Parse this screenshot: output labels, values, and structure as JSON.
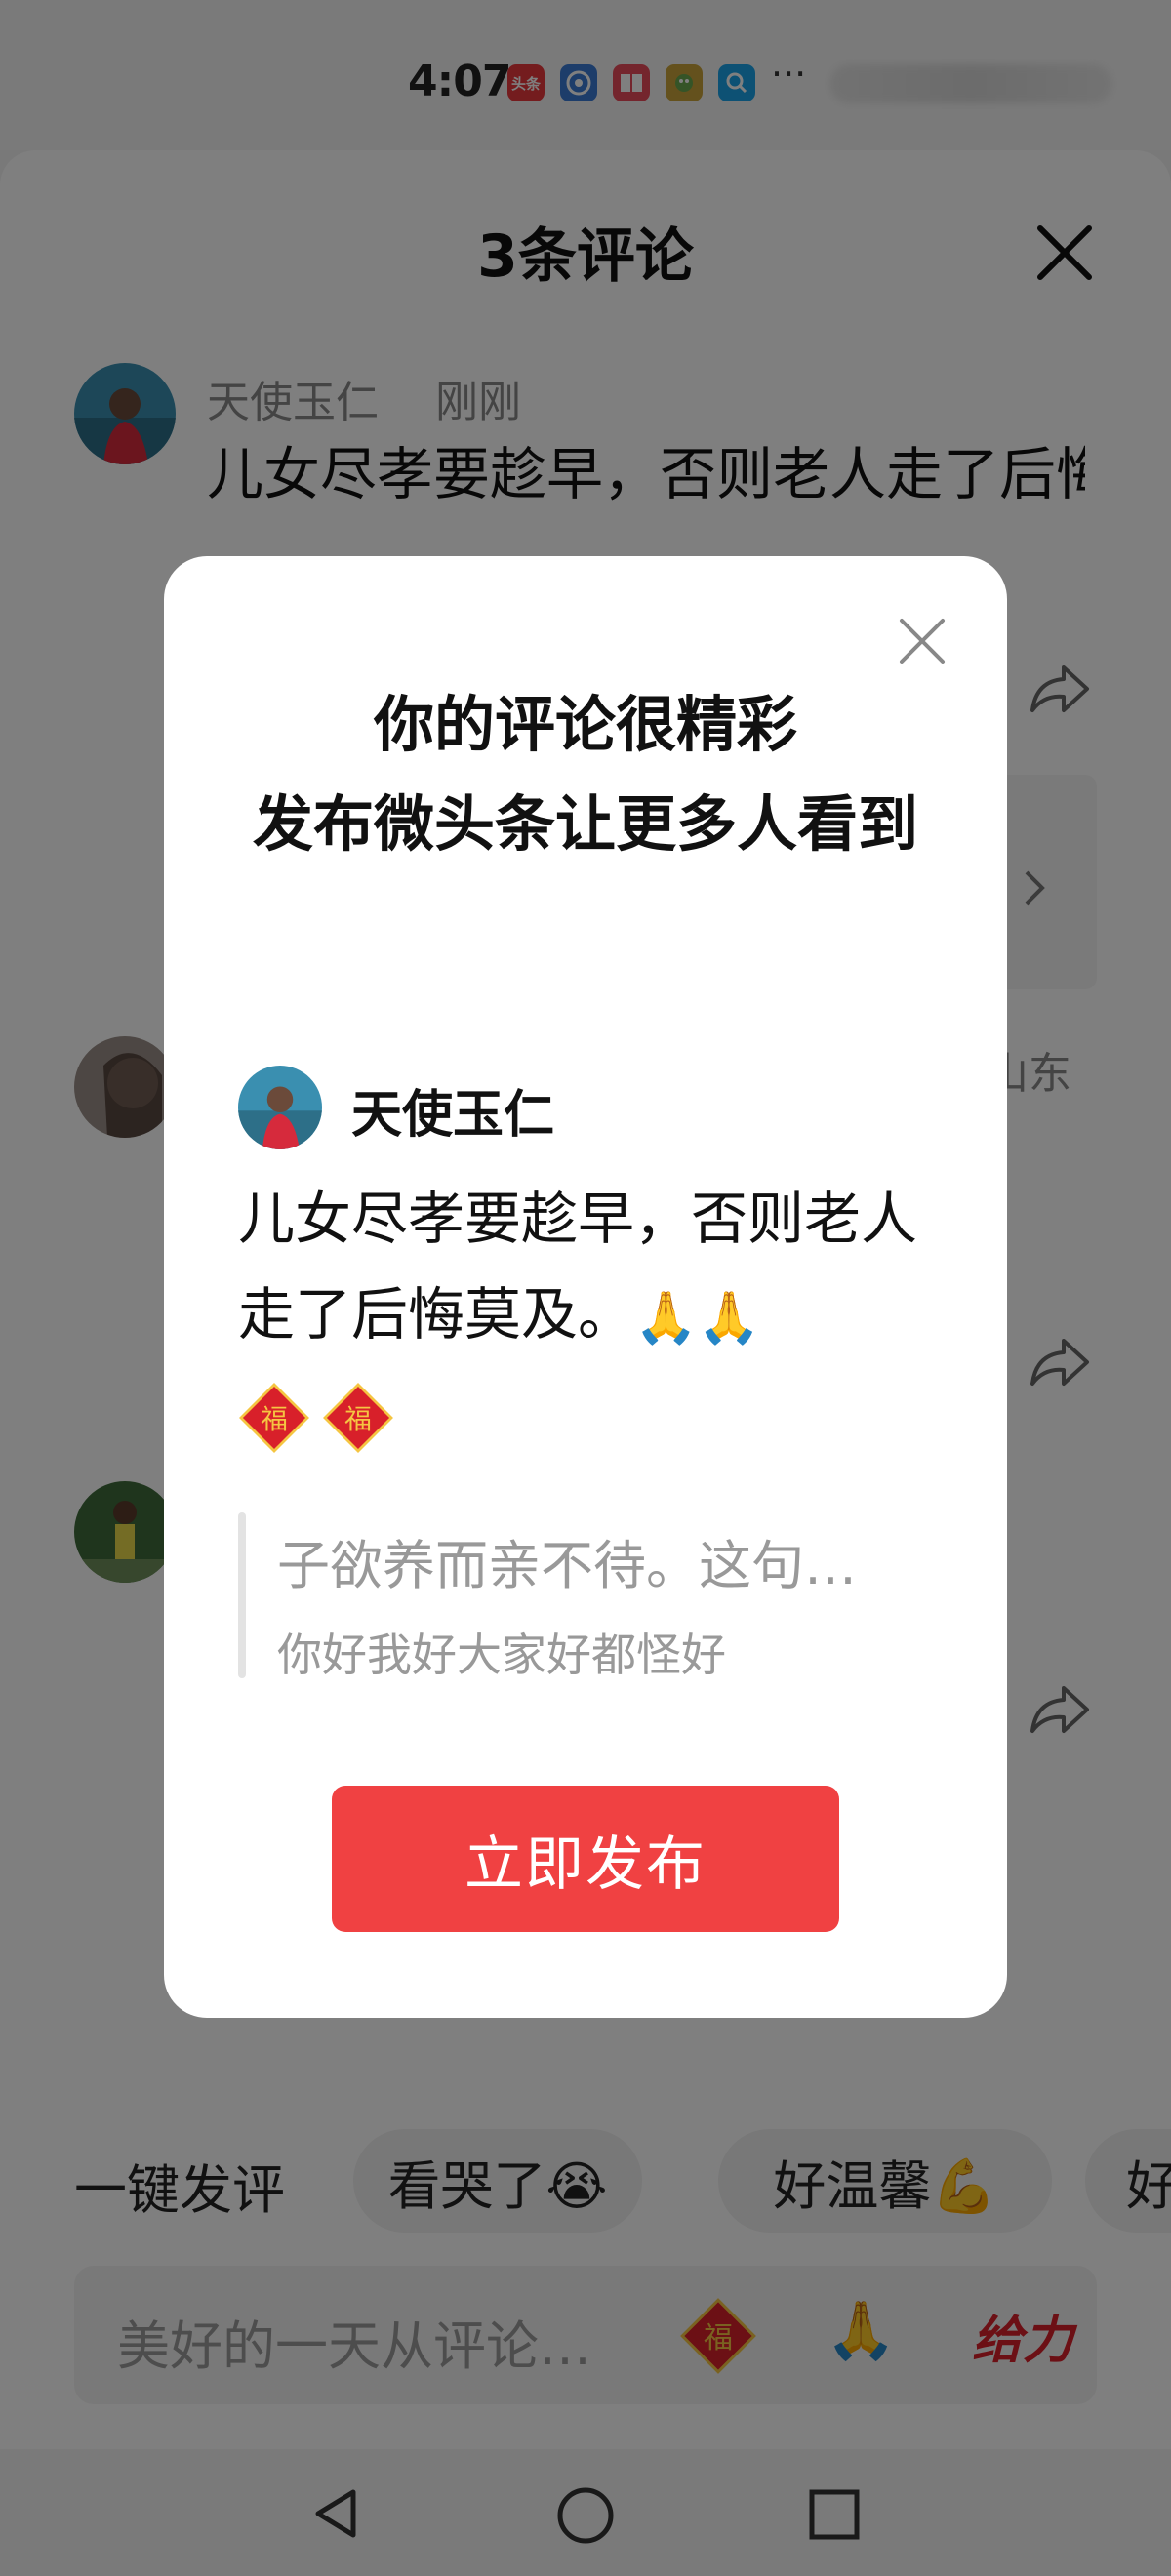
{
  "status_bar": {
    "time": "4:07",
    "app_icons": [
      "toutiao-icon",
      "browser-icon",
      "reader-icon",
      "game-icon",
      "search-app-icon"
    ],
    "more": "···"
  },
  "sheet": {
    "title": "3条评论",
    "comments": [
      {
        "author": "天使玉仁",
        "time": "刚刚",
        "text": "儿女尽孝要趁早，否则老人走了后悔莫及。🙏🙏"
      },
      {
        "location": "山东"
      },
      {}
    ]
  },
  "quick_replies": {
    "label": "一键发评",
    "chips": [
      "看哭了😭",
      "好温馨💪",
      "好"
    ]
  },
  "input": {
    "placeholder": "美好的一天从评论…",
    "emoji_pray": "🙏",
    "emoji_geili": "给力"
  },
  "modal": {
    "title_line1": "你的评论很精彩",
    "title_line2": "发布微头条让更多人看到",
    "author": "天使玉仁",
    "text": "儿女尽孝要趁早，否则老人走了后悔莫及。",
    "pray_emoji": "🙏🙏",
    "fu_char": "福",
    "quote_line1": "子欲养而亲不待。这句…",
    "quote_line2": "你好我好大家好都怪好",
    "publish_label": "立即发布"
  },
  "colors": {
    "accent": "#f04142",
    "fu_red": "#d8202a",
    "fu_gold": "#f5c542"
  }
}
